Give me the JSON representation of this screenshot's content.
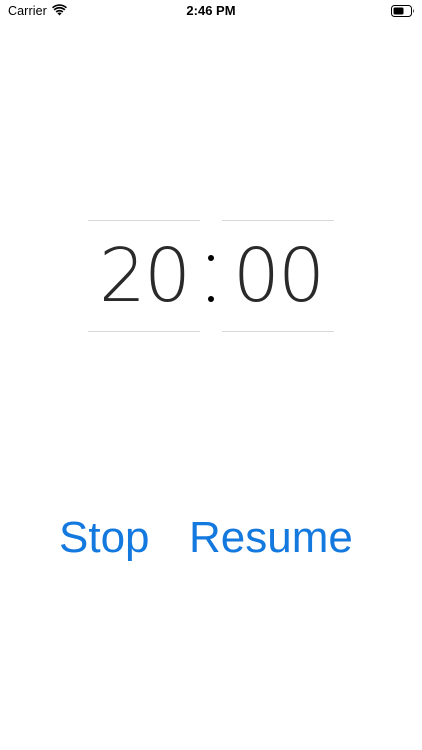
{
  "status_bar": {
    "carrier": "Carrier",
    "time": "2:46 PM",
    "wifi_icon": "wifi-icon",
    "battery_icon": "battery-icon"
  },
  "timer": {
    "minutes": "20",
    "seconds": "00",
    "separator": ":"
  },
  "controls": {
    "stop_label": "Stop",
    "resume_label": "Resume",
    "accent_color": "#1479df"
  }
}
